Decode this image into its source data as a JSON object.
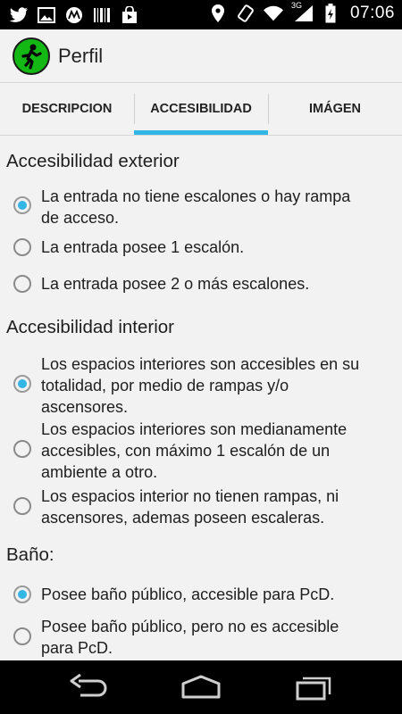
{
  "status_bar": {
    "time": "07:06",
    "left_icons": [
      "twitter-icon",
      "image-icon",
      "motorola-icon",
      "barcode-icon",
      "store-icon"
    ],
    "right_icons": [
      "location-icon",
      "rotate-icon",
      "wifi-icon",
      "3g-signal-icon",
      "battery-icon"
    ],
    "network_label": "3G"
  },
  "action_bar": {
    "title": "Perfil"
  },
  "tabs": [
    {
      "label": "DESCRIPCION",
      "active": false
    },
    {
      "label": "ACCESIBILIDAD",
      "active": true
    },
    {
      "label": "IMÁGEN",
      "active": false
    }
  ],
  "sections": [
    {
      "title": "Accesibilidad exterior",
      "options": [
        {
          "lines": [
            "La entrada no tiene escalones o hay rampa",
            "de acceso."
          ],
          "checked": true
        },
        {
          "lines": [
            "La entrada posee 1 escalón."
          ],
          "checked": false
        },
        {
          "lines": [
            "La entrada posee 2 o más escalones."
          ],
          "checked": false
        }
      ]
    },
    {
      "title": "Accesibilidad interior",
      "options": [
        {
          "lines": [
            "Los espacios interiores son accesibles en su",
            "totalidad, por medio de rampas y/o",
            "ascensores."
          ],
          "checked": true
        },
        {
          "lines": [
            "Los espacios interiores son medianamente",
            "accesibles, con máximo 1 escalón de un",
            "ambiente a otro."
          ],
          "checked": false
        },
        {
          "lines": [
            "Los espacios interior no tienen rampas, ni",
            "ascensores, ademas poseen escaleras."
          ],
          "checked": false
        }
      ]
    },
    {
      "title": "Baño:",
      "options": [
        {
          "lines": [
            "Posee baño público, accesible para PcD."
          ],
          "checked": true
        },
        {
          "lines": [
            "Posee baño público, pero no es accesible",
            "para PcD."
          ],
          "checked": false
        }
      ]
    }
  ],
  "colors": {
    "accent": "#33b5e5",
    "app_icon_green": "#14b814",
    "background": "#f2f2f2"
  }
}
